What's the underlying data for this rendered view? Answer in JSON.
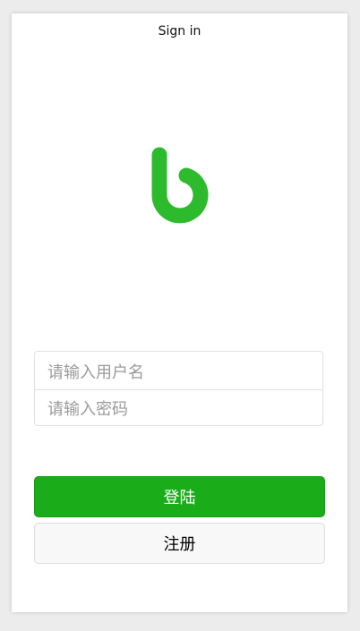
{
  "header": {
    "title": "Sign in"
  },
  "logo": {
    "icon": "app-logo-icon",
    "color": "#2dbb2d"
  },
  "form": {
    "username_placeholder": "请输入用户名",
    "password_placeholder": "请输入密码"
  },
  "buttons": {
    "login_label": "登陆",
    "login_color": "#1aad19",
    "register_label": "注册"
  }
}
